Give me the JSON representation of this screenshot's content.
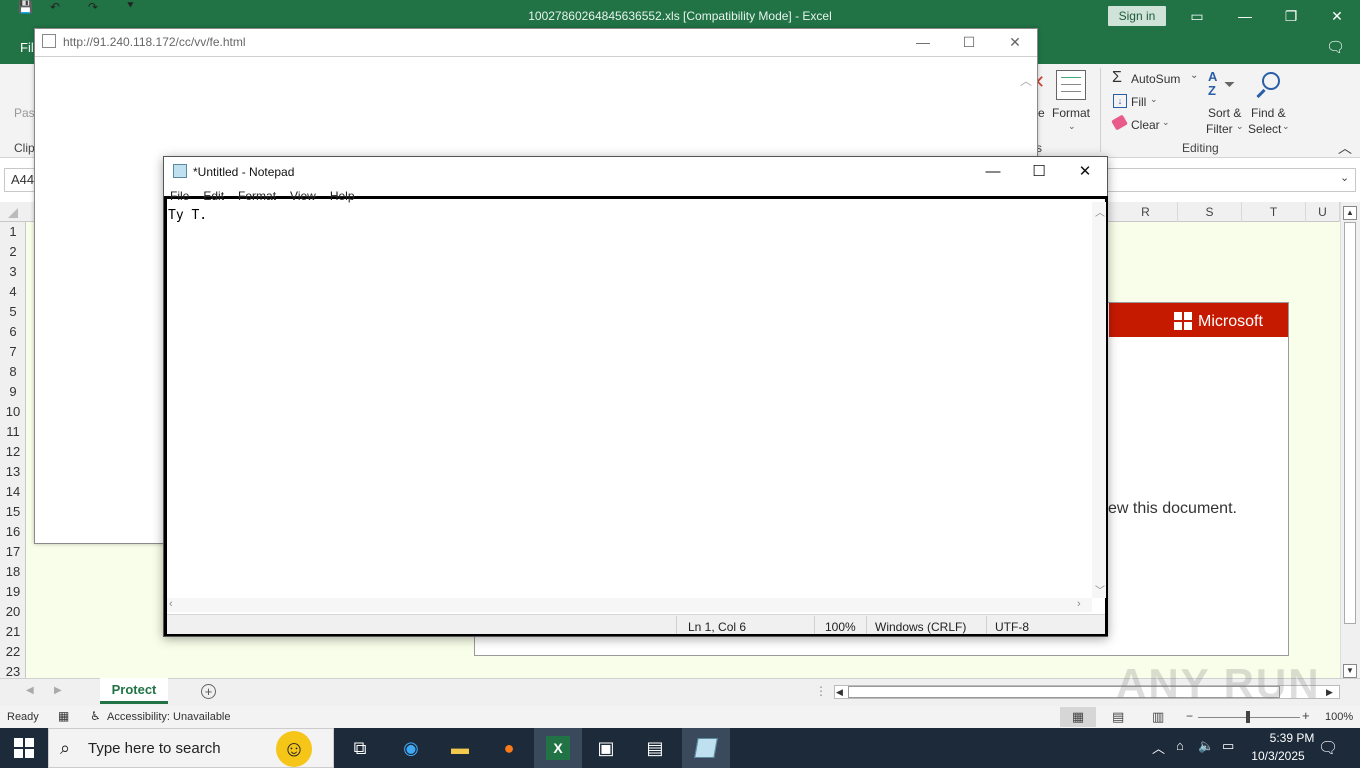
{
  "excel": {
    "title": "10027860264845636552.xls  [Compatibility Mode]  -  Excel",
    "sign_in": "Sign in",
    "file_tab": "Fil",
    "ribbon": {
      "paste_label": "Pas",
      "clip_group": "Clip",
      "format_label": "Format",
      "autosum": "AutoSum",
      "fill": "Fill",
      "clear": "Clear",
      "sort_filter_1": "Sort &",
      "sort_filter_2": "Filter",
      "find_select_1": "Find &",
      "find_select_2": "Select",
      "editing_group": "Editing",
      "partial_e": "e",
      "partial_s": "s"
    },
    "name_box": "A44",
    "columns": [
      "R",
      "S",
      "T",
      "U"
    ],
    "rows": [
      "1",
      "2",
      "3",
      "4",
      "5",
      "6",
      "7",
      "8",
      "9",
      "10",
      "11",
      "12",
      "13",
      "14",
      "15",
      "16",
      "17",
      "18",
      "19",
      "20",
      "21",
      "22",
      "23"
    ],
    "ms_brand": "Microsoft",
    "view_doc_text": "ew this document.",
    "sheet_tab": "Protect",
    "status": {
      "ready": "Ready",
      "accessibility": "Accessibility: Unavailable",
      "zoom": "100%"
    }
  },
  "browser": {
    "url": "http://91.240.118.172/cc/vv/fe.html"
  },
  "notepad": {
    "title": "*Untitled - Notepad",
    "menu": [
      "File",
      "Edit",
      "Format",
      "View",
      "Help"
    ],
    "content": "Ty T.",
    "status": {
      "position": "Ln 1, Col 6",
      "zoom": "100%",
      "line_endings": "Windows (CRLF)",
      "encoding": "UTF-8"
    }
  },
  "taskbar": {
    "search_placeholder": "Type here to search",
    "time": "5:39 PM",
    "date": "10/3/2025"
  },
  "watermark": "ANY RUN",
  "colors": {
    "excel_green": "#217346",
    "ms_red": "#c51a00",
    "sheet_bg": "#f8fee9",
    "taskbar": "#1c2a3a"
  }
}
